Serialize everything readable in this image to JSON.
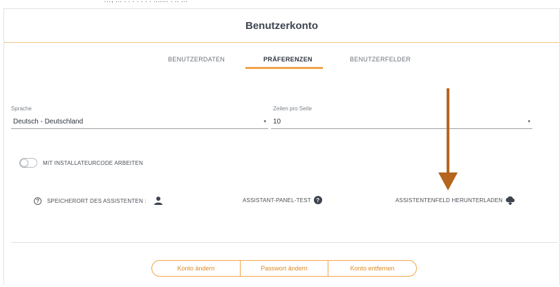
{
  "top_strip_text": "…, ... . . . . . . . ....... . .. ...",
  "header": {
    "title": "Benutzerkonto"
  },
  "tabs": [
    {
      "label": "BENUTZERDATEN"
    },
    {
      "label": "PRÄFERENZEN",
      "active": true
    },
    {
      "label": "BENUTZERFELDER"
    }
  ],
  "language": {
    "label": "Sprache",
    "value": "Deutsch - Deutschland"
  },
  "rows_per_page": {
    "label": "Zeilen pro Seite",
    "value": "10"
  },
  "installer_toggle": {
    "label": "MIT INSTALLATEURCODE ARBEITEN",
    "on": false
  },
  "assistant": {
    "location_label": "SPEICHERORT DES ASSISTENTEN :",
    "panel_test_label": "ASSISTANT-PANEL-TEST",
    "download_label": "ASSISTENTENFELD HERUNTERLADEN"
  },
  "actions": {
    "change_account": "Konto ändern",
    "change_password": "Passwort ändern",
    "remove_account": "Konto entfernen"
  },
  "colors": {
    "accent": "#f0a44a",
    "annotation_arrow": "#b5651d"
  },
  "icons": [
    "help-circle-icon",
    "user-icon",
    "help-filled-icon",
    "cloud-download-icon",
    "dropdown-caret-icon"
  ]
}
